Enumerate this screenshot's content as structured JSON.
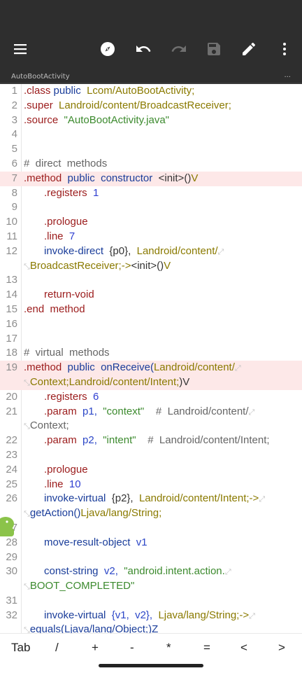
{
  "toolbar": {
    "icons": [
      "menu-icon",
      "compass-icon",
      "undo-icon",
      "redo-icon",
      "save-icon",
      "edit-icon",
      "more-vert-icon"
    ]
  },
  "tab": {
    "title": "AutoBootActivity",
    "overflow": "..."
  },
  "lines": {
    "n1": "1",
    "n2": "2",
    "n3": "3",
    "n4": "4",
    "n5": "5",
    "n6": "6",
    "n7": "7",
    "n8": "8",
    "n9": "9",
    "n10": "10",
    "n11": "11",
    "n12": "12",
    "n13": "13",
    "n14": "14",
    "n15": "15",
    "n16": "16",
    "n17": "17",
    "n18": "18",
    "n19": "19",
    "n20": "20",
    "n21": "21",
    "n22": "22",
    "n23": "23",
    "n24": "24",
    "n25": "25",
    "n26": "26",
    "n27": "27",
    "n28": "28",
    "n29": "29",
    "n30": "30",
    "n31": "31",
    "n32": "32"
  },
  "code": {
    "l1_kw": ".class",
    "l1_pub": "public",
    "l1_cls": "Lcom/AutoBootActivity;",
    "l2_kw": ".super",
    "l2_cls": "Landroid/content/BroadcastReceiver;",
    "l3_kw": ".source",
    "l3_str": "\"AutoBootActivity.java\"",
    "l6_cmt": "#  direct  methods",
    "l7_kw": ".method",
    "l7_pub": "public  constructor",
    "l7_rest": "<init>()",
    "l7_v": "V",
    "l8_kw": ".registers",
    "l8_num": "1",
    "l10_kw": ".prologue",
    "l11_kw": ".line",
    "l11_num": "7",
    "l12_op": "invoke-direct",
    "l12_reg": "{p0},",
    "l12_cls": "Landroid/content/",
    "l12b_cls": "BroadcastReceiver;->",
    "l12b_rest": "<init>()",
    "l12b_v": "V",
    "l14_kw": "return-void",
    "l15_kw": ".end  method",
    "l18_cmt": "#  virtual  methods",
    "l19_kw": ".method",
    "l19_pub": "public  onReceive(",
    "l19_cls": "Landroid/content/",
    "l19b_cls": "Context;Landroid/content/Intent;",
    "l19b_rest": ")V",
    "l20_kw": ".registers",
    "l20_num": "6",
    "l21_kw": ".param",
    "l21_reg": "p1,",
    "l21_str": "\"context\"",
    "l21_cmt": "#  Landroid/content/",
    "l21b_cmt": "Context;",
    "l22_kw": ".param",
    "l22_reg": "p2,",
    "l22_str": "\"intent\"",
    "l22_cmt": "#  Landroid/content/Intent;",
    "l24_kw": ".prologue",
    "l25_kw": ".line",
    "l25_num": "10",
    "l26_op": "invoke-virtual",
    "l26_reg": "{p2},",
    "l26_cls": "Landroid/content/Intent;->",
    "l26b_rest": "getAction()",
    "l26b_cls": "Ljava/lang/String;",
    "l28_op": "move-result-object",
    "l28_reg": "v1",
    "l30_op": "const-string",
    "l30_reg": "v2,",
    "l30_str": "\"android.intent.action.",
    "l30b_str": "BOOT_COMPLETED\"",
    "l32_op": "invoke-virtual",
    "l32_reg": "{v1,  v2},",
    "l32_cls": "Ljava/lang/String;->",
    "l32b_rest": "equals(Ljava/lang/Object;)Z"
  },
  "keys": [
    "Tab",
    "/",
    "+",
    "-",
    "*",
    "=",
    "<",
    ">"
  ],
  "colors": {
    "highlight": "#fde8e8",
    "keyword": "#9b1b1b",
    "public": "#1a3d9a",
    "class": "#8a7a00",
    "string": "#3c8a2e",
    "number": "#2f3fd1"
  }
}
